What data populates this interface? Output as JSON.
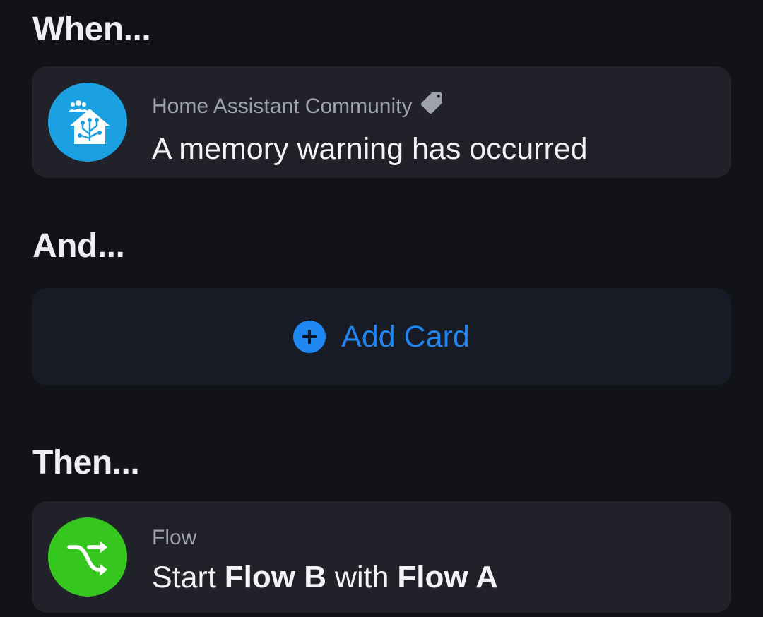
{
  "sections": {
    "when": "When...",
    "and": "And...",
    "then": "Then..."
  },
  "trigger": {
    "app": "Home Assistant Community",
    "title": "A memory warning has occurred",
    "icon": "home-assistant-icon",
    "icon_color": "#1ba1e2",
    "tag_icon": "tag-icon"
  },
  "add_card": {
    "label": "Add Card",
    "icon": "plus-circle-icon",
    "color": "#1f86f2"
  },
  "action": {
    "app": "Flow",
    "title_prefix": "Start",
    "token_1": "Flow B",
    "title_middle": "with",
    "token_2": "Flow A",
    "icon": "shuffle-icon",
    "icon_color": "#36c71e"
  }
}
